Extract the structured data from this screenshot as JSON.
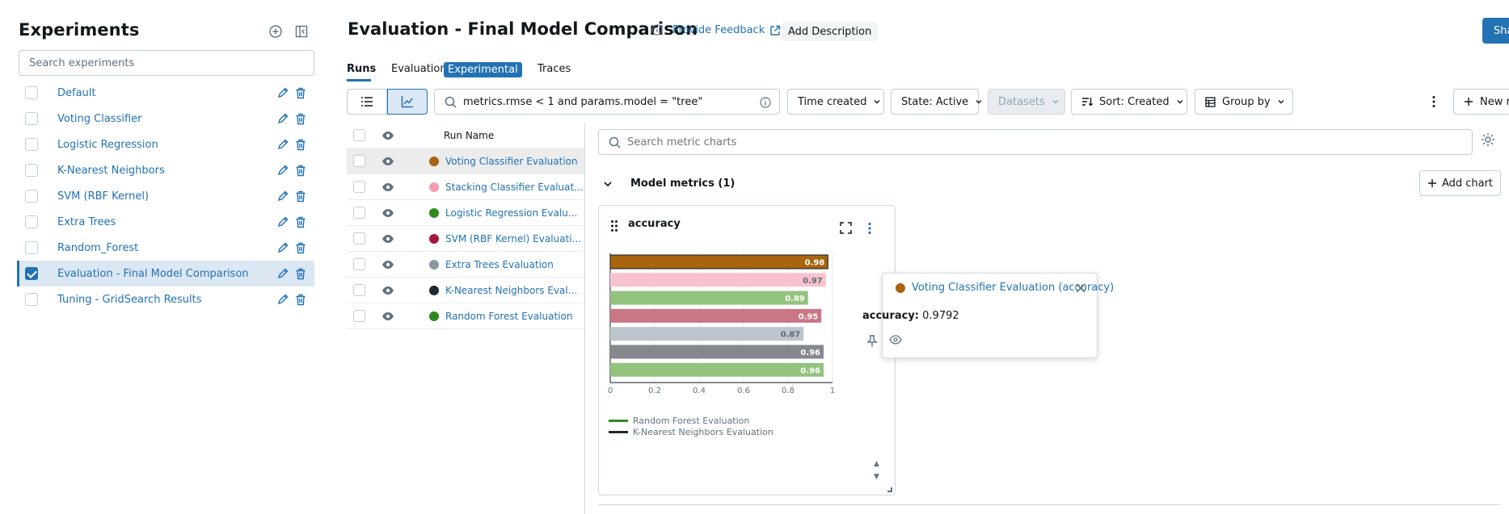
{
  "sidebar": {
    "title": "Experiments",
    "search_placeholder": "Search experiments",
    "items": [
      {
        "label": "Default",
        "checked": false
      },
      {
        "label": "Voting Classifier",
        "checked": false
      },
      {
        "label": "Logistic Regression",
        "checked": false
      },
      {
        "label": "K-Nearest Neighbors",
        "checked": false
      },
      {
        "label": "SVM (RBF Kernel)",
        "checked": false
      },
      {
        "label": "Extra Trees",
        "checked": false
      },
      {
        "label": "Random_Forest",
        "checked": false
      },
      {
        "label": "Evaluation - Final Model Comparison",
        "checked": true
      },
      {
        "label": "Tuning - GridSearch Results",
        "checked": false
      }
    ]
  },
  "header": {
    "title": "Evaluation - Final Model Comparison",
    "feedback": "Provide Feedback",
    "add_description": "Add Description",
    "share": "Share"
  },
  "tabs": {
    "runs": "Runs",
    "evaluation": "Evaluation",
    "experimental": "Experimental",
    "traces": "Traces"
  },
  "toolbar": {
    "search_value": "metrics.rmse < 1 and params.model = \"tree\"",
    "time_created": "Time created",
    "state": "State: Active",
    "datasets": "Datasets",
    "sort": "Sort: Created",
    "group_by": "Group by",
    "new_run": "New run"
  },
  "runs": {
    "header": "Run Name",
    "rows": [
      {
        "name": "Voting Classifier Evaluation",
        "color": "#a8640e"
      },
      {
        "name": "Stacking Classifier Evaluat...",
        "color": "#f49eb0"
      },
      {
        "name": "Logistic Regression Evalu...",
        "color": "#2e8a1e"
      },
      {
        "name": "SVM (RBF Kernel) Evaluati...",
        "color": "#a8173a"
      },
      {
        "name": "Extra Trees Evaluation",
        "color": "#8c96a3"
      },
      {
        "name": "K-Nearest Neighbors Eval...",
        "color": "#222831"
      },
      {
        "name": "Random Forest Evaluation",
        "color": "#2e8a1e"
      }
    ]
  },
  "charts": {
    "search_placeholder": "Search metric charts",
    "section": "Model metrics (1)",
    "add_chart": "Add chart"
  },
  "chart_data": {
    "type": "bar",
    "title": "accuracy",
    "orientation": "horizontal",
    "xlim": [
      0,
      1
    ],
    "xticks": [
      "0",
      "0.2",
      "0.4",
      "0.6",
      "0.8",
      "1"
    ],
    "bars": [
      {
        "value": 0.9792,
        "label": "0.98",
        "color": "#a8640e"
      },
      {
        "value": 0.97,
        "label": "0.97",
        "color": "#f7c2cd"
      },
      {
        "value": 0.89,
        "label": "0.89",
        "color": "#94c27f"
      },
      {
        "value": 0.95,
        "label": "0.95",
        "color": "#c97787"
      },
      {
        "value": 0.87,
        "label": "0.87",
        "color": "#bcc4cc"
      },
      {
        "value": 0.96,
        "label": "0.96",
        "color": "#85888d"
      },
      {
        "value": 0.96,
        "label": "0.96",
        "color": "#94c27f"
      }
    ],
    "legend": [
      {
        "name": "Random Forest Evaluation",
        "color": "#2e8a1e"
      },
      {
        "name": "K-Nearest Neighbors Evaluation",
        "color": "#222831"
      }
    ]
  },
  "tooltip": {
    "title": "Voting Classifier Evaluation (accuracy)",
    "color": "#a8640e",
    "metric_name": "accuracy:",
    "metric_value": "0.9792"
  }
}
